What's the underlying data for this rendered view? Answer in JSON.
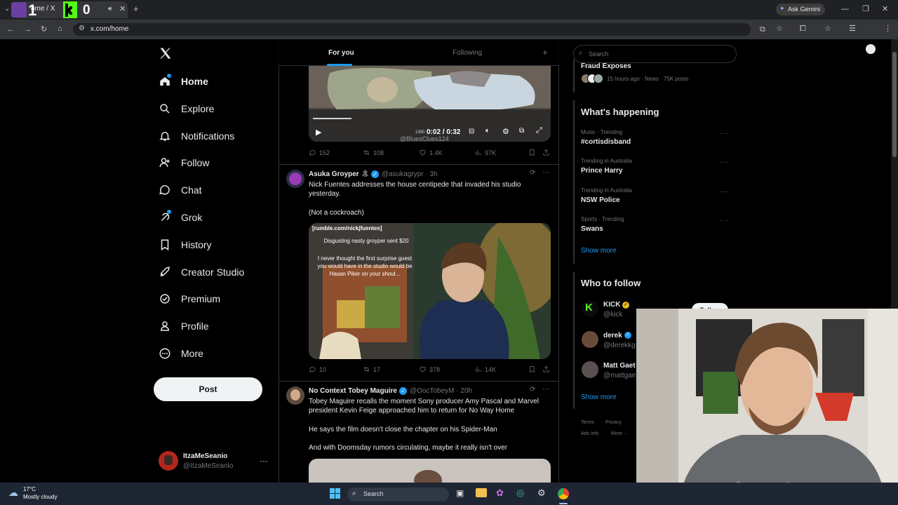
{
  "browser": {
    "tab_title": "ome / X",
    "tab_overlay_text": "1",
    "tab_overlay_counter": "0",
    "url": "x.com/home",
    "gemini_label": "Ask Gemini"
  },
  "nav": {
    "items": [
      {
        "label": "Home",
        "icon": "home-icon"
      },
      {
        "label": "Explore",
        "icon": "search-icon"
      },
      {
        "label": "Notifications",
        "icon": "bell-icon"
      },
      {
        "label": "Follow",
        "icon": "person-plus-icon"
      },
      {
        "label": "Chat",
        "icon": "chat-icon"
      },
      {
        "label": "Grok",
        "icon": "grok-icon"
      },
      {
        "label": "History",
        "icon": "bookmark-icon"
      },
      {
        "label": "Creator Studio",
        "icon": "rocket-icon"
      },
      {
        "label": "Premium",
        "icon": "verified-icon"
      },
      {
        "label": "Profile",
        "icon": "person-icon"
      },
      {
        "label": "More",
        "icon": "more-circle-icon"
      }
    ],
    "post_label": "Post",
    "account": {
      "name": "ItzaMeSeanio",
      "handle": "@ItzaMeSeanio"
    }
  },
  "feed": {
    "tabs": {
      "for_you": "For you",
      "following": "Following"
    },
    "video1": {
      "time": "0:02 / 0:32",
      "watermark": "@BluesClues124",
      "small": "1990"
    },
    "post1_stats": {
      "replies": "152",
      "reposts": "108",
      "likes": "1.4K",
      "views": "97K"
    },
    "post2": {
      "name": "Asuka Groyper",
      "name_suffix": "🏝",
      "handle": "@asukagrypr · 3h",
      "text1": "Nick Fuentes addresses the house centipede that invaded his studio yesterday.",
      "text2": "(Not a cockroach)",
      "media_source": "[rumble.com/nickjfuentes]",
      "media_caption1": "Disgusting nasty groyper sent $20",
      "media_caption2": "I never thought the first surprise guest you would have in the studio would be Hasan Piker on your shoul...",
      "stats": {
        "replies": "10",
        "reposts": "17",
        "likes": "378",
        "views": "14K"
      }
    },
    "post3": {
      "name": "No Context Tobey Maguire",
      "handle": "@OocTobeyM · 20h",
      "text1": "Tobey Maguire recalls the moment Sony producer Amy Pascal and Marvel president Kevin Feige approached him to return for No Way Home",
      "text2": "He says the film doesn't close the chapter on his Spider-Man",
      "text3": "And with Doomsday rumors circulating, maybe it really isn't over"
    }
  },
  "sidebar": {
    "search_placeholder": "Search",
    "top_card": {
      "title": "Fraud Exposes",
      "meta": "15 hours ago · News · 75K posts"
    },
    "happening": {
      "title": "What's happening",
      "trends": [
        {
          "category": "Music · Trending",
          "name": "#cortisdisband"
        },
        {
          "category": "Trending in Australia",
          "name": "Prince Harry"
        },
        {
          "category": "Trending in Australia",
          "name": "NSW Police"
        },
        {
          "category": "Sports · Trending",
          "name": "Swans"
        }
      ],
      "show_more": "Show more"
    },
    "who_to_follow": {
      "title": "Who to follow",
      "accounts": [
        {
          "name": "KICK",
          "handle": "@kick"
        },
        {
          "name": "derek",
          "handle": "@derekkg"
        },
        {
          "name": "Matt Gaet",
          "handle": "@mattgae"
        }
      ],
      "follow_label": "Follow",
      "show_more": "Show more"
    },
    "footer": {
      "terms": "Terms",
      "privacy": "Privacy",
      "ads": "Ads info",
      "more": "More ···"
    }
  },
  "taskbar": {
    "temp": "17°C",
    "weather": "Mostly cloudy",
    "search_label": "Search"
  }
}
